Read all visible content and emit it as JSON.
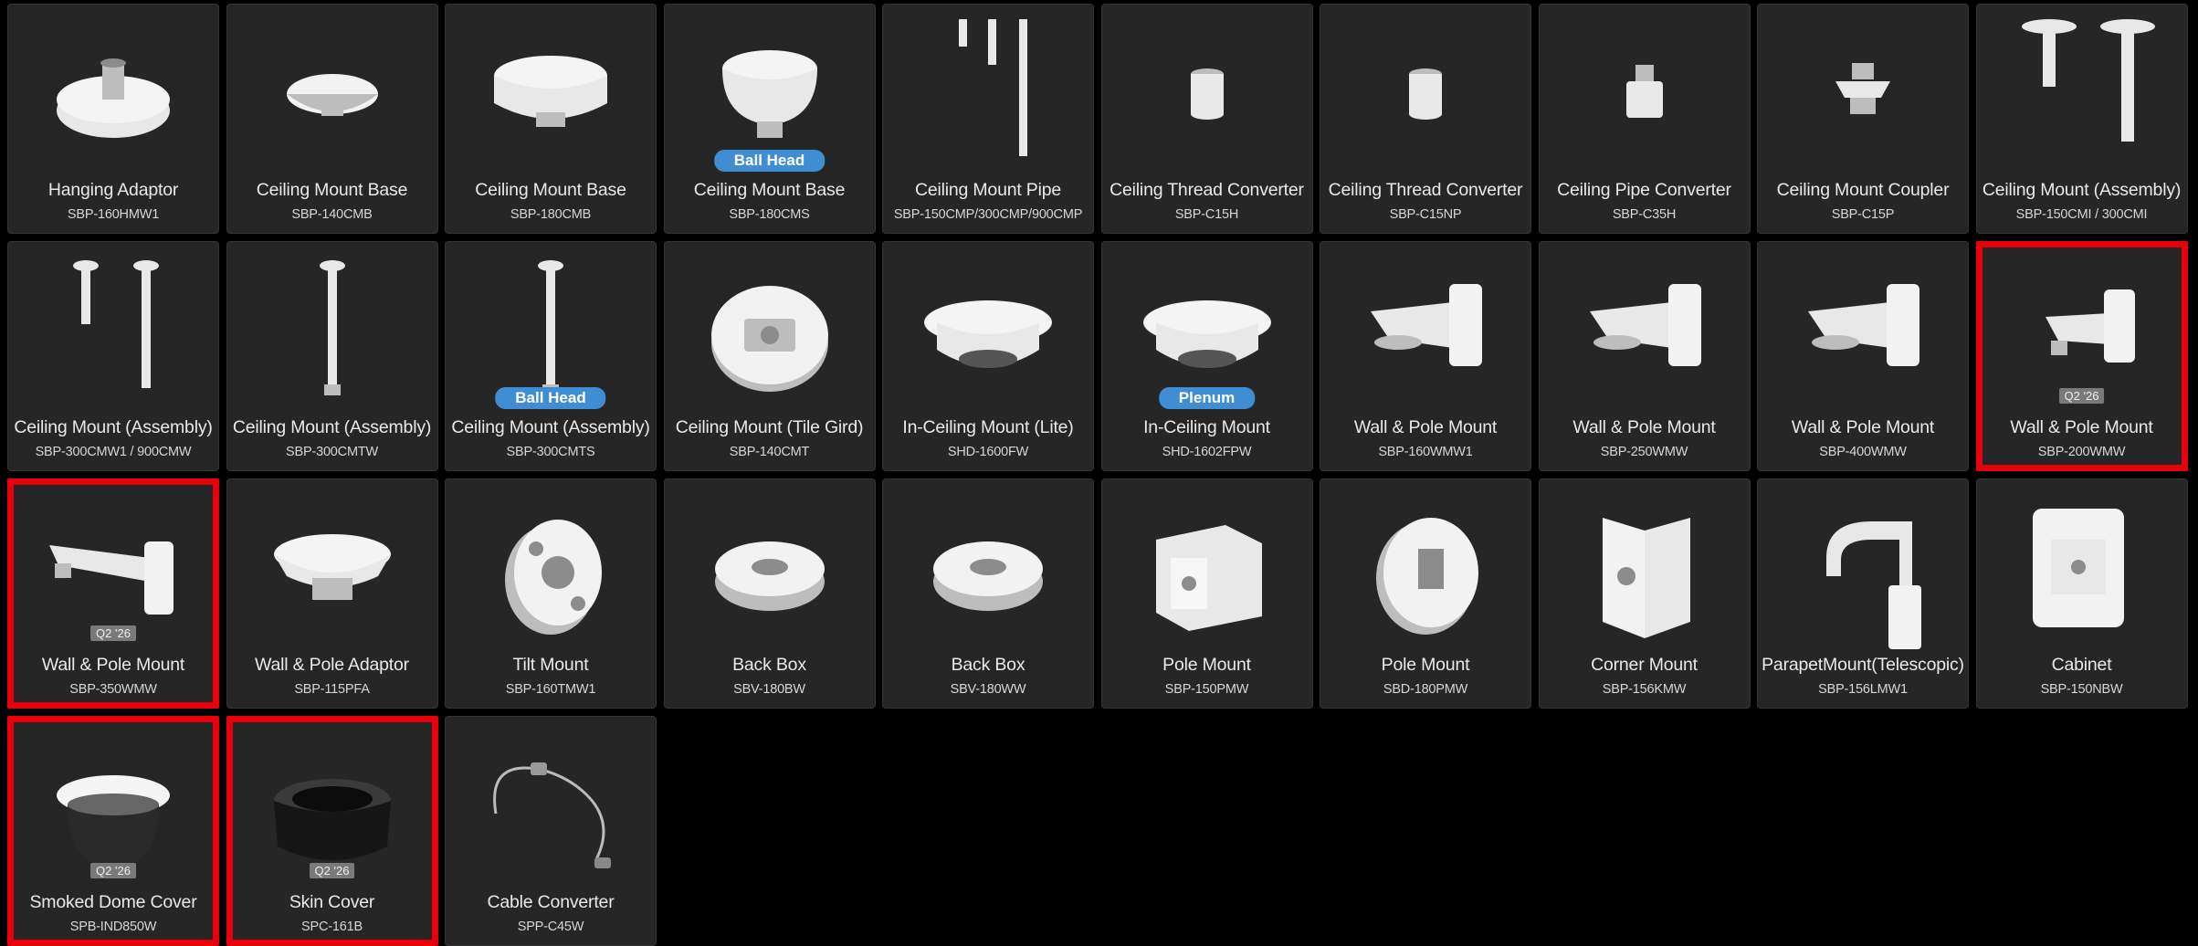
{
  "highlight_color": "#e8000b",
  "badge_color": "#3f8ed4",
  "products": [
    {
      "name": "Hanging Adaptor",
      "model": "SBP-160HMW1",
      "icon": "hanging-adaptor-icon"
    },
    {
      "name": "Ceiling Mount Base",
      "model": "SBP-140CMB",
      "icon": "ceiling-base-icon"
    },
    {
      "name": "Ceiling Mount Base",
      "model": "SBP-180CMB",
      "icon": "ceiling-base-large-icon"
    },
    {
      "name": "Ceiling Mount Base",
      "model": "SBP-180CMS",
      "icon": "ball-head-base-icon",
      "badge": "Ball Head"
    },
    {
      "name": "Ceiling Mount Pipe",
      "model": "SBP-150CMP/300CMP/900CMP",
      "icon": "pipes-icon"
    },
    {
      "name": "Ceiling Thread Converter",
      "model": "SBP-C15H",
      "icon": "thread-converter-icon"
    },
    {
      "name": "Ceiling Thread Converter",
      "model": "SBP-C15NP",
      "icon": "thread-converter-icon"
    },
    {
      "name": "Ceiling Pipe Converter",
      "model": "SBP-C35H",
      "icon": "pipe-converter-icon"
    },
    {
      "name": "Ceiling Mount Coupler",
      "model": "SBP-C15P",
      "icon": "coupler-icon"
    },
    {
      "name": "Ceiling Mount (Assembly)",
      "model": "SBP-150CMI / 300CMI",
      "icon": "ceiling-assembly-icon"
    },
    {
      "name": "Ceiling Mount (Assembly)",
      "model": "SBP-300CMW1 / 900CMW",
      "icon": "pendant-pair-icon"
    },
    {
      "name": "Ceiling Mount (Assembly)",
      "model": "SBP-300CMTW",
      "icon": "pendant-icon"
    },
    {
      "name": "Ceiling Mount (Assembly)",
      "model": "SBP-300CMTS",
      "icon": "pendant-icon",
      "badge": "Ball Head"
    },
    {
      "name": "Ceiling Mount (Tile Gird)",
      "model": "SBP-140CMT",
      "icon": "tile-grid-plate-icon"
    },
    {
      "name": "In-Ceiling Mount (Lite)",
      "model": "SHD-1600FW",
      "icon": "in-ceiling-icon"
    },
    {
      "name": "In-Ceiling Mount",
      "model": "SHD-1602FPW",
      "icon": "in-ceiling-icon",
      "badge": "Plenum"
    },
    {
      "name": "Wall & Pole Mount",
      "model": "SBP-160WMW1",
      "icon": "wall-mount-icon"
    },
    {
      "name": "Wall & Pole Mount",
      "model": "SBP-250WMW",
      "icon": "wall-mount-icon"
    },
    {
      "name": "Wall & Pole Mount",
      "model": "SBP-400WMW",
      "icon": "wall-mount-icon"
    },
    {
      "name": "Wall & Pole Mount",
      "model": "SBP-200WMW",
      "icon": "wall-mount-small-icon",
      "qbadge": "Q2 '26",
      "highlight": true
    },
    {
      "name": "Wall & Pole Mount",
      "model": "SBP-350WMW",
      "icon": "wall-mount-arm-icon",
      "qbadge": "Q2 '26",
      "highlight": true
    },
    {
      "name": "Wall & Pole Adaptor",
      "model": "SBP-115PFA",
      "icon": "adaptor-icon"
    },
    {
      "name": "Tilt Mount",
      "model": "SBP-160TMW1",
      "icon": "tilt-mount-icon"
    },
    {
      "name": "Back Box",
      "model": "SBV-180BW",
      "icon": "back-box-icon"
    },
    {
      "name": "Back Box",
      "model": "SBV-180WW",
      "icon": "back-box-icon"
    },
    {
      "name": "Pole Mount",
      "model": "SBP-150PMW",
      "icon": "pole-mount-icon"
    },
    {
      "name": "Pole Mount",
      "model": "SBD-180PMW",
      "icon": "round-pole-mount-icon"
    },
    {
      "name": "Corner Mount",
      "model": "SBP-156KMW",
      "icon": "corner-mount-icon"
    },
    {
      "name": "ParapetMount(Telescopic)",
      "model": "SBP-156LMW1",
      "icon": "parapet-mount-icon"
    },
    {
      "name": "Cabinet",
      "model": "SBP-150NBW",
      "icon": "cabinet-icon"
    },
    {
      "name": "Smoked Dome Cover",
      "model": "SPB-IND850W",
      "icon": "smoked-dome-icon",
      "qbadge": "Q2 '26",
      "highlight": true
    },
    {
      "name": "Skin Cover",
      "model": "SPC-161B",
      "icon": "skin-cover-icon",
      "qbadge": "Q2 '26",
      "highlight": true
    },
    {
      "name": "Cable Converter",
      "model": "SPP-C45W",
      "icon": "cable-icon"
    }
  ]
}
